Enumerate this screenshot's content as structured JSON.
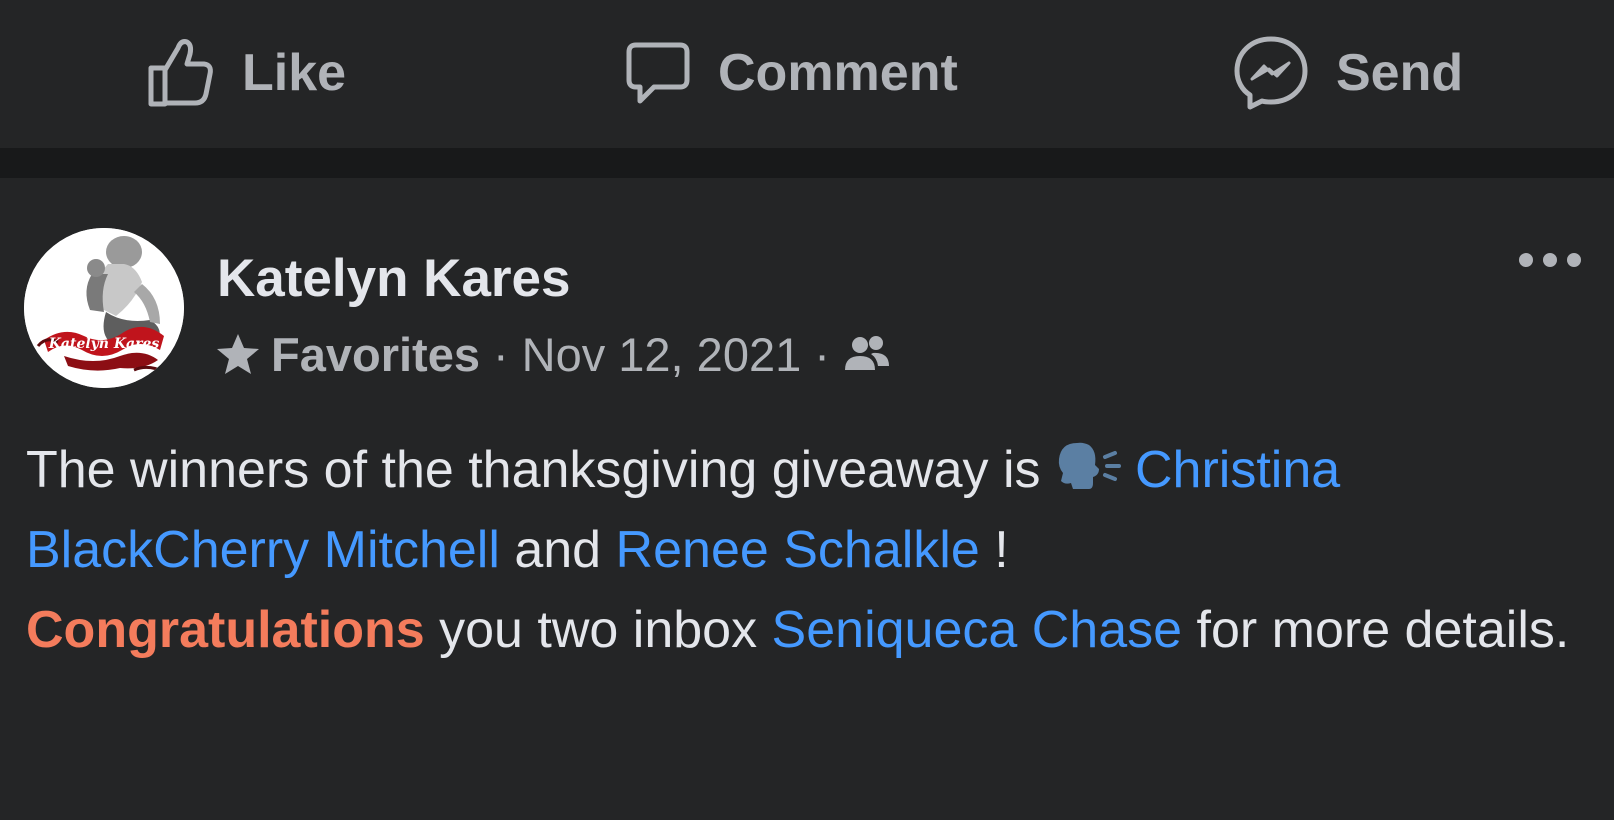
{
  "actions": {
    "like_label": "Like",
    "comment_label": "Comment",
    "send_label": "Send"
  },
  "post": {
    "author": "Katelyn Kares",
    "avatar_caption": "Katelyn Kares",
    "meta": {
      "favorites_label": "Favorites",
      "separator": "·",
      "date": "Nov 12, 2021",
      "audience_icon": "friends-icon"
    },
    "body": {
      "intro": "The winners of the thanksgiving giveaway is ",
      "emoji": "speaking-head-emoji",
      "mention_1": "Christina BlackCherry Mitchell",
      "and": " and ",
      "mention_2": "Renee Schalkle",
      "exclaim": " !",
      "congrats": "Congratulations",
      "middle": " you two inbox ",
      "mention_3": "Seniqueca Chase",
      "end": " for more details."
    }
  },
  "colors": {
    "background": "#242526",
    "separator": "#18191a",
    "text": "#e4e6eb",
    "muted": "#b0b3b8",
    "mention": "#4599ff",
    "highlight": "#f47c5c"
  }
}
